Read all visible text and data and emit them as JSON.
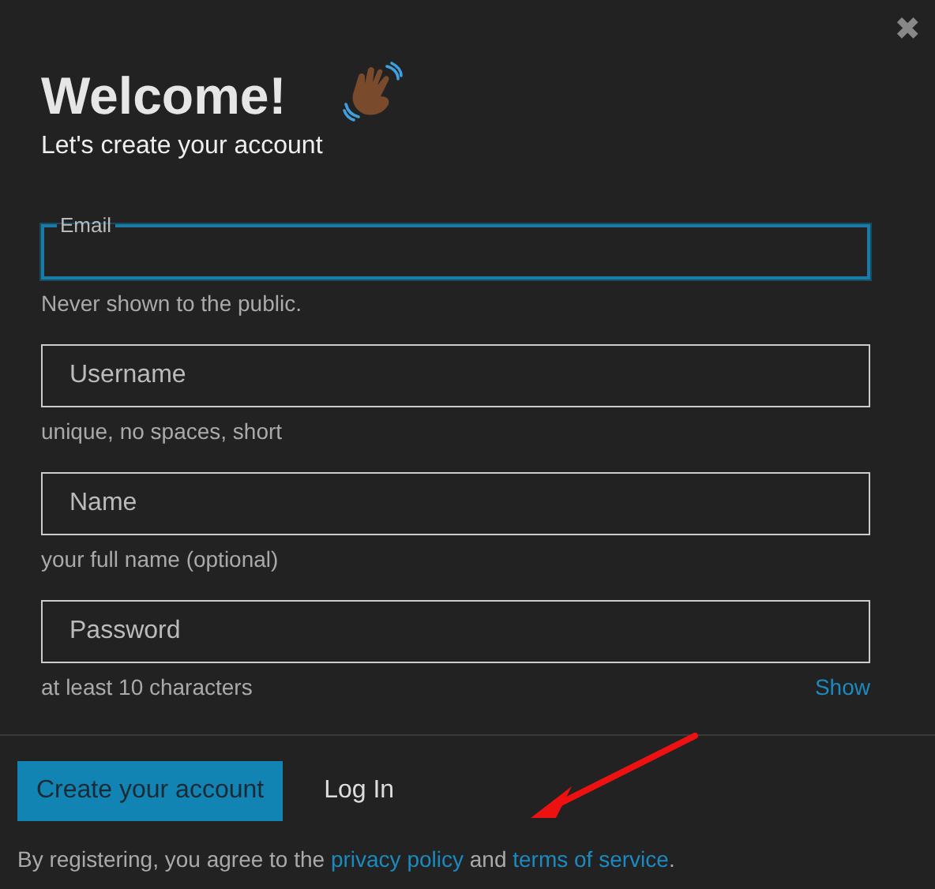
{
  "close": {
    "label": "✖"
  },
  "title": "Welcome!",
  "subtitle": "Let's create your account",
  "fields": [
    {
      "kind": "labeled",
      "label": "Email",
      "focused": true,
      "hint": "Never shown to the public."
    },
    {
      "kind": "placeholder",
      "placeholder": "Username",
      "focused": false,
      "hint": "unique, no spaces, short"
    },
    {
      "kind": "placeholder",
      "placeholder": "Name",
      "focused": false,
      "hint": "your full name (optional)"
    },
    {
      "kind": "placeholder",
      "placeholder": "Password",
      "focused": false,
      "hint": "at least 10 characters",
      "action": "Show"
    }
  ],
  "buttons": [
    {
      "kind": "primary",
      "label": "Create your account"
    },
    {
      "kind": "plain",
      "label": "Log In"
    }
  ],
  "legal": [
    {
      "kind": "text",
      "text": "By registering, you agree to the "
    },
    {
      "kind": "link",
      "text": "privacy policy"
    },
    {
      "kind": "text",
      "text": " and "
    },
    {
      "kind": "link",
      "text": "terms of service"
    },
    {
      "kind": "text",
      "text": "."
    }
  ]
}
